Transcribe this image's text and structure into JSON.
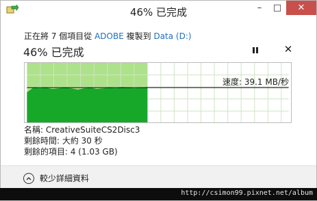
{
  "window": {
    "title": "46% 已完成",
    "minimize_label": "–",
    "maximize_label": "□",
    "close_label": "✕"
  },
  "copy": {
    "prefix": "正在將 7 個項目從 ",
    "source": "ADOBE",
    "middle": " 複製到 ",
    "destination": "Data (D:)",
    "progress_text": "46% 已完成",
    "progress_percent": 46,
    "speed_text": "速度: 39.1 MB/秒"
  },
  "details": {
    "name_label": "名稱: ",
    "name_value": "CreativeSuiteCS2Disc3",
    "time_label": "剩餘時間: ",
    "time_value": "大約 30 秒",
    "items_label": "剩餘的項目: ",
    "items_value": "4 (1.03 GB)"
  },
  "footer": {
    "less_details_label": "較少詳細資料"
  },
  "watermark": "http://csimon99.pixnet.net/album",
  "colors": {
    "progress_fill": "#aee28a",
    "speed_area": "#17a82a",
    "grid": "#cfe3c5",
    "link": "#1e6fbd"
  },
  "icons": {
    "app": "copy-arrow-icon",
    "pause": "pause-icon",
    "cancel": "close-icon",
    "expand": "chevron-up-icon"
  }
}
